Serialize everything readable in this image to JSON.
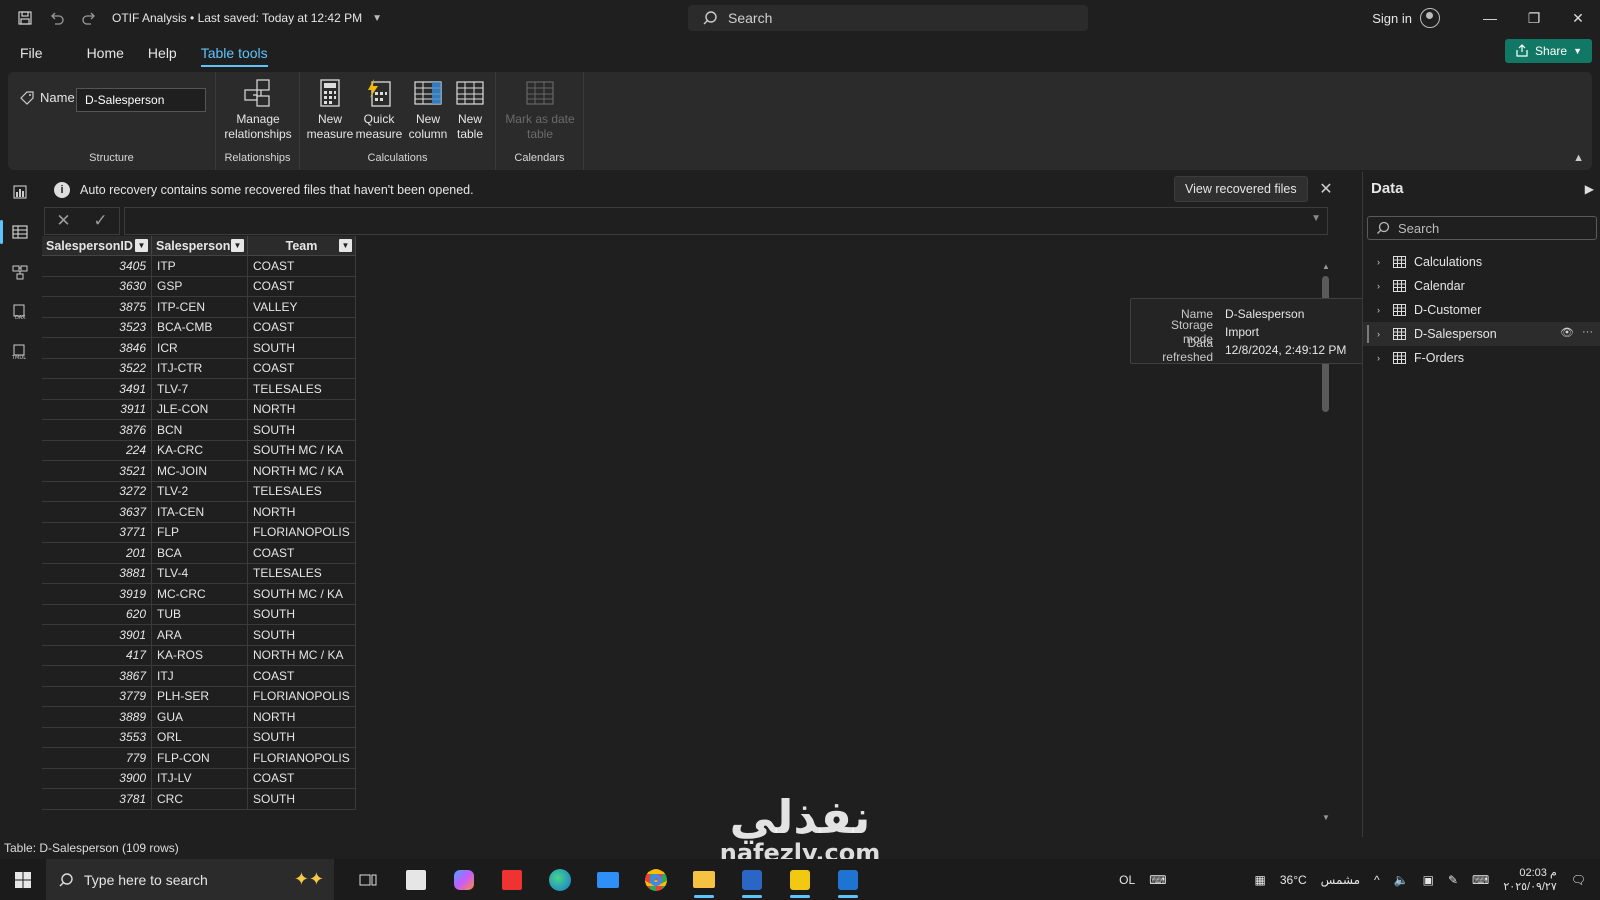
{
  "titlebar": {
    "doc_title": "OTIF Analysis",
    "saved_status": "Last saved: Today at 12:42 PM",
    "search_placeholder": "Search",
    "signin": "Sign in"
  },
  "menu": {
    "file": "File",
    "home": "Home",
    "help": "Help",
    "table_tools": "Table tools",
    "share": "Share"
  },
  "ribbon": {
    "name_label": "Name",
    "name_value": "D-Salesperson",
    "structure_label": "Structure",
    "manage_relationships_line1": "Manage",
    "manage_relationships_line2": "relationships",
    "relationships_label": "Relationships",
    "new_measure_line1": "New",
    "new_measure_line2": "measure",
    "quick_measure_line1": "Quick",
    "quick_measure_line2": "measure",
    "new_column_line1": "New",
    "new_column_line2": "column",
    "new_table_line1": "New",
    "new_table_line2": "table",
    "calculations_label": "Calculations",
    "mark_date_line1": "Mark as date",
    "mark_date_line2": "table",
    "calendars_label": "Calendars"
  },
  "infobar": {
    "message": "Auto recovery contains some recovered files that haven't been opened.",
    "view_button": "View recovered files"
  },
  "table": {
    "columns": [
      "SalespersonID",
      "Salesperson",
      "Team"
    ],
    "rows": [
      [
        "3405",
        "ITP",
        "COAST"
      ],
      [
        "3630",
        "GSP",
        "COAST"
      ],
      [
        "3875",
        "ITP-CEN",
        "VALLEY"
      ],
      [
        "3523",
        "BCA-CMB",
        "COAST"
      ],
      [
        "3846",
        "ICR",
        "SOUTH"
      ],
      [
        "3522",
        "ITJ-CTR",
        "COAST"
      ],
      [
        "3491",
        "TLV-7",
        "TELESALES"
      ],
      [
        "3911",
        "JLE-CON",
        "NORTH"
      ],
      [
        "3876",
        "BCN",
        "SOUTH"
      ],
      [
        "224",
        "KA-CRC",
        "SOUTH MC / KA"
      ],
      [
        "3521",
        "MC-JOIN",
        "NORTH MC / KA"
      ],
      [
        "3272",
        "TLV-2",
        "TELESALES"
      ],
      [
        "3637",
        "ITA-CEN",
        "NORTH"
      ],
      [
        "3771",
        "FLP",
        "FLORIANOPOLIS"
      ],
      [
        "201",
        "BCA",
        "COAST"
      ],
      [
        "3881",
        "TLV-4",
        "TELESALES"
      ],
      [
        "3919",
        "MC-CRC",
        "SOUTH MC / KA"
      ],
      [
        "620",
        "TUB",
        "SOUTH"
      ],
      [
        "3901",
        "ARA",
        "SOUTH"
      ],
      [
        "417",
        "KA-ROS",
        "NORTH MC / KA"
      ],
      [
        "3867",
        "ITJ",
        "COAST"
      ],
      [
        "3779",
        "PLH-SER",
        "FLORIANOPOLIS"
      ],
      [
        "3889",
        "GUA",
        "NORTH"
      ],
      [
        "3553",
        "ORL",
        "SOUTH"
      ],
      [
        "779",
        "FLP-CON",
        "FLORIANOPOLIS"
      ],
      [
        "3900",
        "ITJ-LV",
        "COAST"
      ],
      [
        "3781",
        "CRC",
        "SOUTH"
      ]
    ]
  },
  "tooltip": {
    "name_key": "Name",
    "name_val": "D-Salesperson",
    "mode_key": "Storage mode",
    "mode_val": "Import",
    "refreshed_key": "Data refreshed",
    "refreshed_val": "12/8/2024, 2:49:12 PM"
  },
  "datapane": {
    "title": "Data",
    "search_placeholder": "Search",
    "tables": [
      "Calculations",
      "Calendar",
      "D-Customer",
      "D-Salesperson",
      "F-Orders"
    ]
  },
  "statusbar": {
    "text": "Table: D-Salesperson (109 rows)"
  },
  "taskbar": {
    "search_placeholder": "Type here to search",
    "lang": "OL",
    "weather_temp": "36°C",
    "weather_desc": "مشمس",
    "time": "02:03 م",
    "date": "٢٠٢٥/٠٩/٢٧"
  },
  "watermark": {
    "arabic": "نفذلي",
    "latin": "nafezly.com"
  }
}
